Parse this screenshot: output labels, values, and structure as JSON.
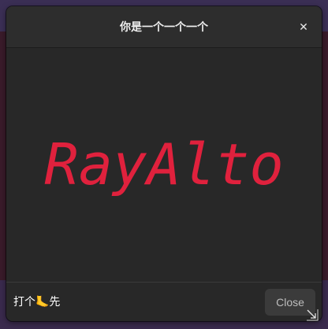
{
  "dialog": {
    "title": "你是一个一个一个",
    "close_icon_glyph": "✕",
    "preview_text": "RayAlto",
    "preview_color": "#e0213d",
    "footer_label": "打个🦶先",
    "close_button_label": "Close"
  },
  "icons": {
    "titlebar_close": "close-icon",
    "resize": "resize-handle-icon"
  }
}
